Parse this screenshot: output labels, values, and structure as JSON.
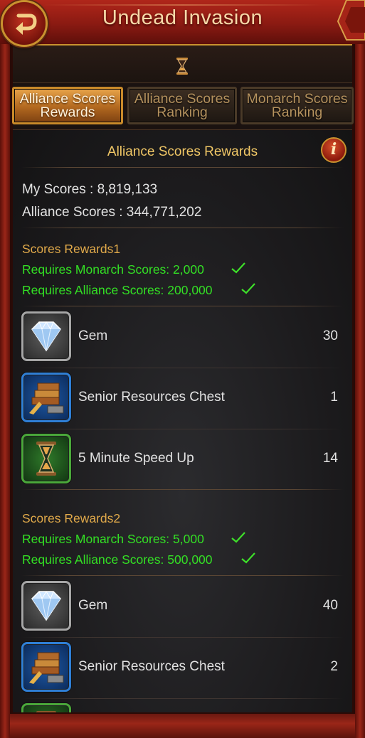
{
  "header": {
    "title": "Undead Invasion"
  },
  "tabs": [
    {
      "label": "Alliance Scores\nRewards",
      "active": true
    },
    {
      "label": "Alliance Scores\nRanking",
      "active": false
    },
    {
      "label": "Monarch Scores\nRanking",
      "active": false
    }
  ],
  "panel": {
    "title": "Alliance Scores Rewards",
    "info_label": "i",
    "my_scores": "My Scores : 8,819,133",
    "alliance_scores": "Alliance Scores : 344,771,202"
  },
  "reward_groups": [
    {
      "title": "Scores Rewards1",
      "requirements": [
        {
          "text": "Requires Monarch Scores: 2,000",
          "met": true
        },
        {
          "text": "Requires Alliance Scores: 200,000",
          "met": true
        }
      ],
      "items": [
        {
          "name": "Gem",
          "qty": "30",
          "icon": "gem-icon",
          "frame": "gray"
        },
        {
          "name": "Senior Resources Chest",
          "qty": "1",
          "icon": "resources-chest-icon",
          "frame": "blue"
        },
        {
          "name": "5 Minute Speed Up",
          "qty": "14",
          "icon": "hourglass-icon",
          "frame": "green"
        }
      ]
    },
    {
      "title": "Scores Rewards2",
      "requirements": [
        {
          "text": "Requires Monarch Scores: 5,000",
          "met": true
        },
        {
          "text": "Requires Alliance Scores: 500,000",
          "met": true
        }
      ],
      "items": [
        {
          "name": "Gem",
          "qty": "40",
          "icon": "gem-icon",
          "frame": "gray"
        },
        {
          "name": "Senior Resources Chest",
          "qty": "2",
          "icon": "resources-chest-icon",
          "frame": "blue"
        },
        {
          "name": "",
          "qty": "",
          "icon": "hourglass-icon",
          "frame": "green"
        }
      ]
    }
  ],
  "colors": {
    "header_red": "#9a2018",
    "gold_title": "#f6d9a8",
    "section_orange": "#e0a94a",
    "requirement_green": "#33e024",
    "active_tab": "#d08a34"
  }
}
